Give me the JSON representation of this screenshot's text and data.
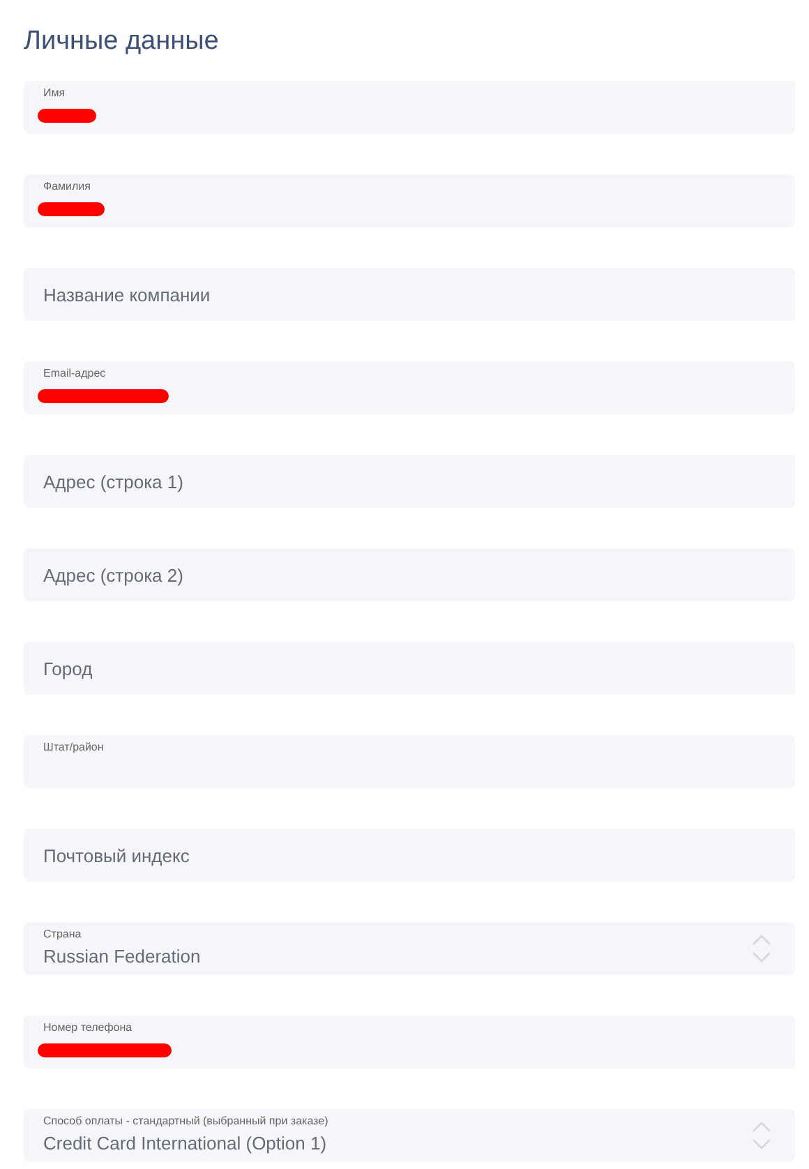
{
  "title": "Личные данные",
  "fields": [
    {
      "kind": "floating",
      "label": "Имя",
      "redacted": true
    },
    {
      "kind": "floating",
      "label": "Фамилия",
      "redacted": true
    },
    {
      "kind": "plain",
      "placeholder": "Название компании"
    },
    {
      "kind": "floating",
      "label": "Email-адрес",
      "redacted": true
    },
    {
      "kind": "plain",
      "placeholder": "Адрес (строка 1)"
    },
    {
      "kind": "plain",
      "placeholder": "Адрес (строка 2)"
    },
    {
      "kind": "plain",
      "placeholder": "Город"
    },
    {
      "kind": "floating",
      "label": "Штат/район",
      "redacted": false
    },
    {
      "kind": "plain",
      "placeholder": "Почтовый индекс"
    },
    {
      "kind": "select",
      "label": "Страна",
      "value": "Russian Federation"
    },
    {
      "kind": "floating",
      "label": "Номер телефона",
      "redacted": true
    },
    {
      "kind": "select",
      "label": "Способ оплаты - стандартный (выбранный при заказе)",
      "value": "Credit Card International (Option 1)"
    }
  ]
}
